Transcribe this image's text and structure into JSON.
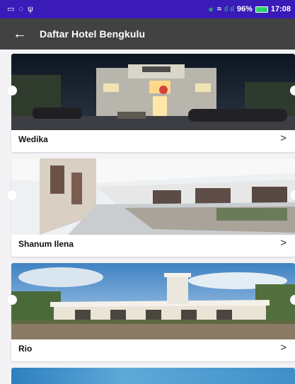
{
  "status_bar": {
    "battery_percent": "96%",
    "time": "17:08",
    "signal_text": "̳̲ ııı ııı",
    "icons": [
      "gallery-icon",
      "shield-icon",
      "usb-icon",
      "bluetooth-icon",
      "wifi-icon",
      "signal-icon",
      "battery-icon"
    ]
  },
  "app_bar": {
    "title": "Daftar Hotel Bengkulu",
    "back_icon": "arrow-left-icon"
  },
  "hotels": [
    {
      "name": "Wedika",
      "chevron": ">"
    },
    {
      "name": "Shanum Ilena",
      "chevron": ">"
    },
    {
      "name": "Rio",
      "chevron": ">"
    }
  ],
  "colors": {
    "status_bar": "#3a1bb8",
    "app_bar": "#424242",
    "background": "#f3f3f6"
  }
}
